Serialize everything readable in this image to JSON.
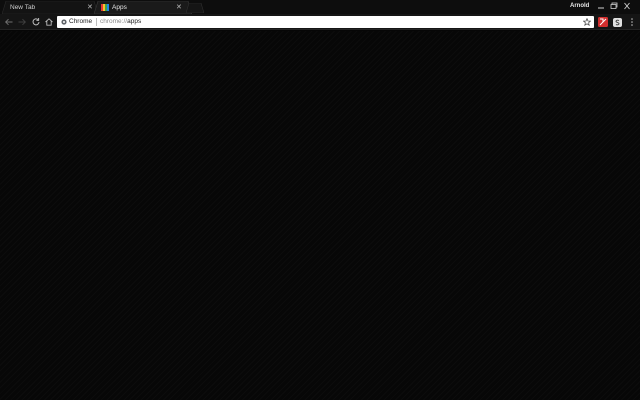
{
  "tabs": [
    {
      "title": "New Tab",
      "active": false
    },
    {
      "title": "Apps",
      "active": true
    }
  ],
  "window": {
    "user_name": "Arnold"
  },
  "omnibox": {
    "chip_label": "Chrome",
    "url_prefix": "chrome://",
    "url_host": "apps"
  },
  "colors": {
    "frame": "#0d0d0d",
    "toolbar": "#151515",
    "content": "#070707",
    "omnibox": "#ffffff"
  },
  "icons": {
    "back": "arrow-left-icon",
    "forward": "arrow-right-icon",
    "reload": "reload-icon",
    "home": "home-icon",
    "bookmark": "star-icon",
    "menu": "kebab-menu-icon"
  }
}
